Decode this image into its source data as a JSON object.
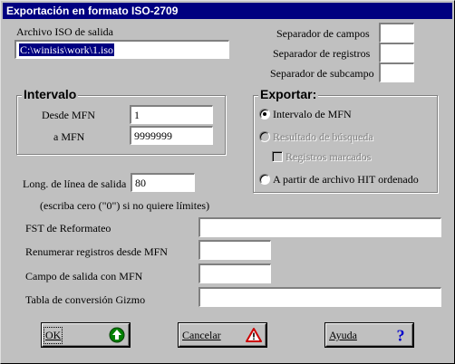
{
  "window": {
    "title": "Exportación en formato ISO-2709"
  },
  "output": {
    "archivo_label": "Archivo ISO de salida",
    "archivo_value": "C:\\winisis\\work\\1.iso"
  },
  "separators": {
    "campos_label": "Separador de campos",
    "campos_value": "",
    "registros_label": "Separador de registros",
    "registros_value": "",
    "subcampo_label": "Separador de subcampo",
    "subcampo_value": ""
  },
  "intervalo": {
    "title": "Intervalo",
    "desde_label": "Desde MFN",
    "desde_value": "1",
    "hasta_label": "a MFN",
    "hasta_value": "9999999"
  },
  "exportar": {
    "title": "Exportar:",
    "options": [
      {
        "label": "Intervalo de MFN",
        "checked": true,
        "enabled": true
      },
      {
        "label": "Resultado de búsqueda",
        "checked": false,
        "enabled": false
      },
      {
        "label": "A partir de archivo HIT ordenado",
        "checked": false,
        "enabled": true
      }
    ],
    "registros_marcados_label": "Registros marcados"
  },
  "linea": {
    "label": "Long. de línea de salida",
    "value": "80",
    "hint": "(escriba cero (\"0\") si no quiere límites)"
  },
  "fst": {
    "label": "FST de Reformateo",
    "value": ""
  },
  "renumerar": {
    "label": "Renumerar registros desde MFN",
    "value": ""
  },
  "campo_salida": {
    "label": "Campo de salida con MFN",
    "value": ""
  },
  "gizmo": {
    "label": "Tabla de conversión Gizmo",
    "value": ""
  },
  "buttons": {
    "ok_label": "OK",
    "cancel_label": "Cancelar",
    "help_label": "Ayuda"
  },
  "icons": {
    "ok": "green-up-arrow-icon",
    "cancel": "warning-triangle-icon",
    "help": "question-mark-icon"
  },
  "colors": {
    "titlebar": "#000080",
    "selection": "#000080",
    "ok_icon": "#008000",
    "cancel_icon": "#cc0000",
    "help_icon": "#0000cc"
  }
}
